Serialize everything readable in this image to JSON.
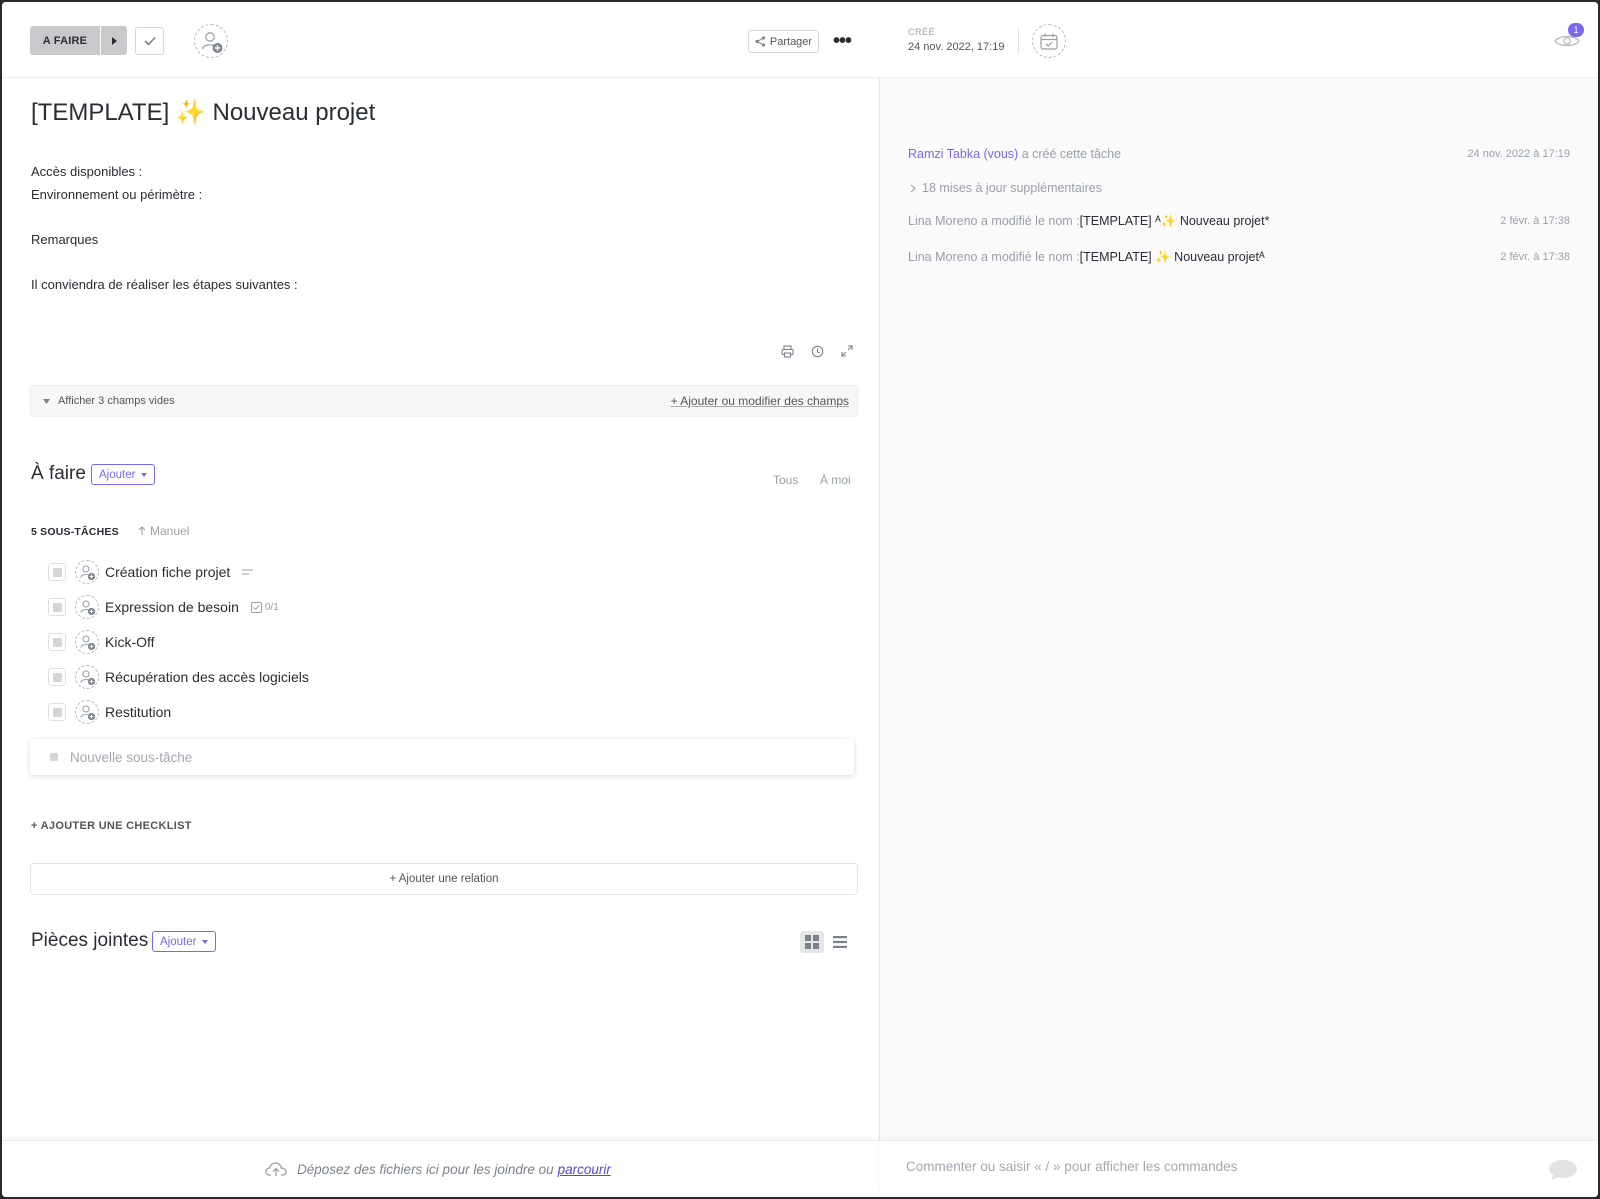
{
  "header": {
    "status_label": "A FAIRE",
    "share_label": "Partager",
    "more_label": "•••"
  },
  "meta": {
    "created_label": "CRÉÉ",
    "created_date": "24 nov. 2022, 17:19",
    "watchers_count": "1"
  },
  "task": {
    "title_prefix": "[TEMPLATE]",
    "title_emoji": "✨",
    "title_text": "Nouveau projet",
    "description": [
      "Accès disponibles :",
      "Environnement ou périmètre :",
      "",
      "Remarques",
      "",
      "Il conviendra de réaliser les étapes suivantes :"
    ]
  },
  "fields": {
    "toggle_label": "Afficher 3 champs vides",
    "edit_label": "+ Ajouter ou modifier des champs"
  },
  "todo": {
    "title": "À faire",
    "add_label": "Ajouter",
    "filter_all": "Tous",
    "filter_me": "À moi",
    "subtasks_count": "5 SOUS-TÂCHES",
    "sort_label": "Manuel",
    "subtasks": [
      {
        "name": "Création fiche projet",
        "extra": ""
      },
      {
        "name": "Expression de besoin",
        "extra": "0/1"
      },
      {
        "name": "Kick-Off",
        "extra": ""
      },
      {
        "name": "Récupération des accès logiciels",
        "extra": ""
      },
      {
        "name": "Restitution",
        "extra": ""
      }
    ],
    "new_subtask_placeholder": "Nouvelle sous-tâche",
    "add_checklist": "+ AJOUTER UNE CHECKLIST",
    "add_relation": "+ Ajouter une relation"
  },
  "attachments": {
    "title": "Pièces jointes",
    "add_label": "Ajouter",
    "drop_text": "Déposez des fichiers ici pour les joindre ou",
    "browse_link": "parcourir"
  },
  "activity": {
    "entries": [
      {
        "who": "Ramzi Tabka (vous)",
        "action": "a créé cette tâche",
        "detail": "",
        "time": "24 nov. 2022 à 17:19"
      },
      {
        "who": "Lina Moreno",
        "action": "a modifié le nom :",
        "detail": "[TEMPLATE] ᴬ✨ Nouveau projet*",
        "time": "2 févr. à 17:38"
      },
      {
        "who": "Lina Moreno",
        "action": "a modifié le nom :",
        "detail": "[TEMPLATE] ✨ Nouveau projetᴬ",
        "time": "2 févr. à 17:38"
      }
    ],
    "more_updates": "18 mises à jour supplémentaires"
  },
  "comment": {
    "placeholder": "Commenter ou saisir « / » pour afficher les commandes"
  },
  "colors": {
    "accent": "#7b68ee",
    "status_bg": "#c9c9cc",
    "link": "#5b47d6"
  }
}
